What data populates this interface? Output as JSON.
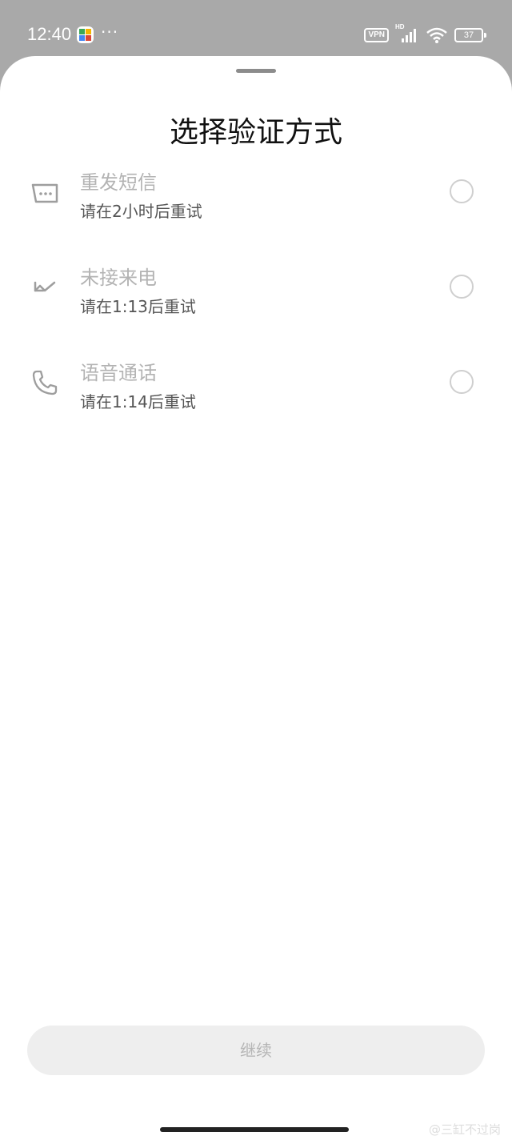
{
  "status_bar": {
    "time": "12:40",
    "app_icon": "colorful-app-icon",
    "dots": "···",
    "vpn_label": "VPN",
    "hd_label": "HD",
    "battery_level": "37"
  },
  "sheet": {
    "title": "选择验证方式",
    "options": [
      {
        "title": "重发短信",
        "subtitle": "请在2小时后重试",
        "icon": "message-icon"
      },
      {
        "title": "未接来电",
        "subtitle": "请在1:13后重试",
        "icon": "missed-call-icon"
      },
      {
        "title": "语音通话",
        "subtitle": "请在1:14后重试",
        "icon": "phone-icon"
      }
    ],
    "continue_label": "继续"
  },
  "watermark": "@三缸不过岗",
  "colors": {
    "background_overlay": "#a9a9a9",
    "sheet": "#ffffff",
    "disabled_text": "#b3b3b3",
    "button_bg": "#eeeeee"
  }
}
